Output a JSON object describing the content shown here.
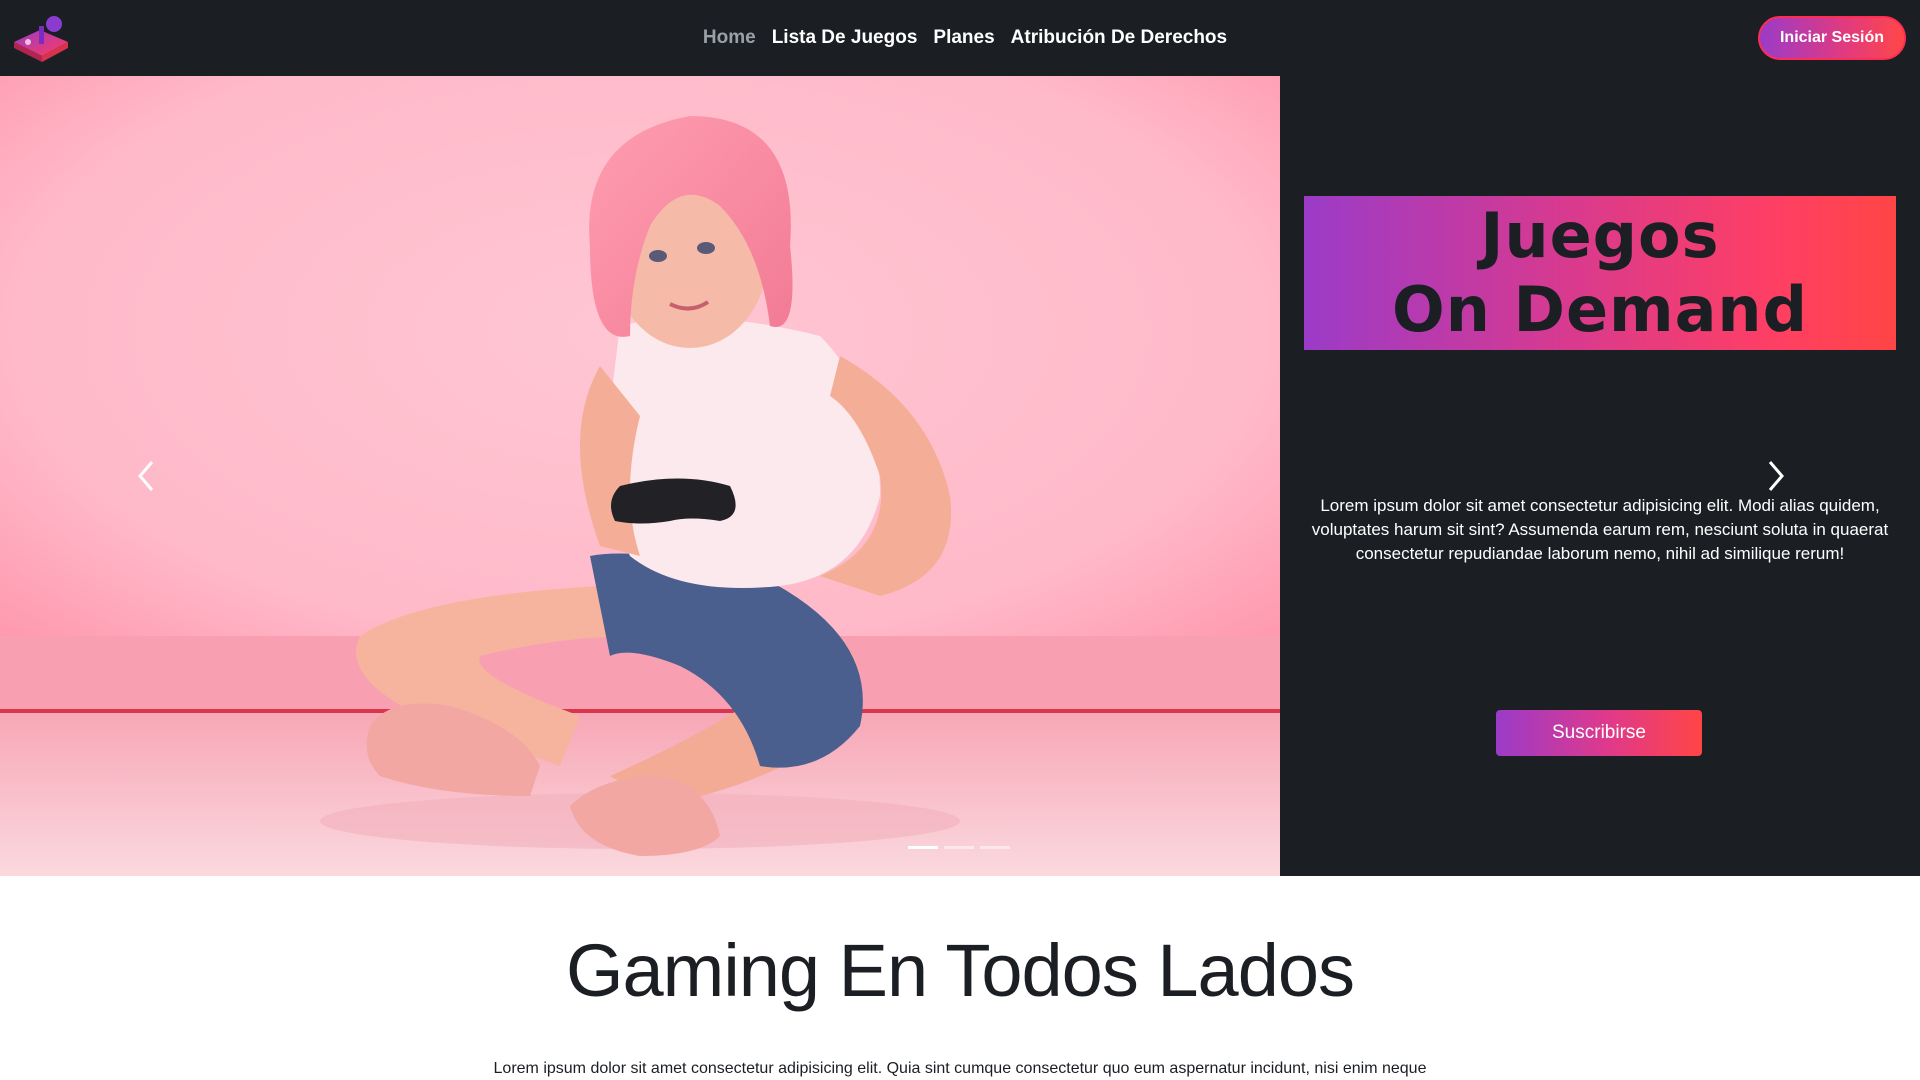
{
  "nav": {
    "logo_icon": "joystick-icon",
    "links": [
      "Home",
      "Lista De Juegos",
      "Planes",
      "Atribución De Derechos"
    ],
    "active_link": "Home",
    "login_label": "Iniciar Sesión"
  },
  "hero": {
    "image_desc_icon": "gamer-girl-photo",
    "title_line1": "Juegos",
    "title_line2": "On Demand",
    "text": "Lorem ipsum dolor sit amet consectetur adipisicing elit. Modi alias quidem, voluptates harum sit sint? Assumenda earum rem, nesciunt soluta in quaerat consectetur repudiandae laborum nemo, nihil ad similique rerum!",
    "subscribe_label": "Suscribirse",
    "prev_icon": "chevron-left-icon",
    "next_icon": "chevron-right-icon",
    "slide_count": 3,
    "active_slide": 1
  },
  "section": {
    "title": "Gaming En Todos Lados",
    "text": "Lorem ipsum dolor sit amet consectetur adipisicing elit. Quia sint cumque consectetur quo eum aspernatur incidunt, nisi enim neque"
  },
  "colors": {
    "dark": "#1b1f24",
    "gradient_start": "#9b3bc8",
    "gradient_end": "#ff4545",
    "hero_pink": "#ffbfce"
  }
}
